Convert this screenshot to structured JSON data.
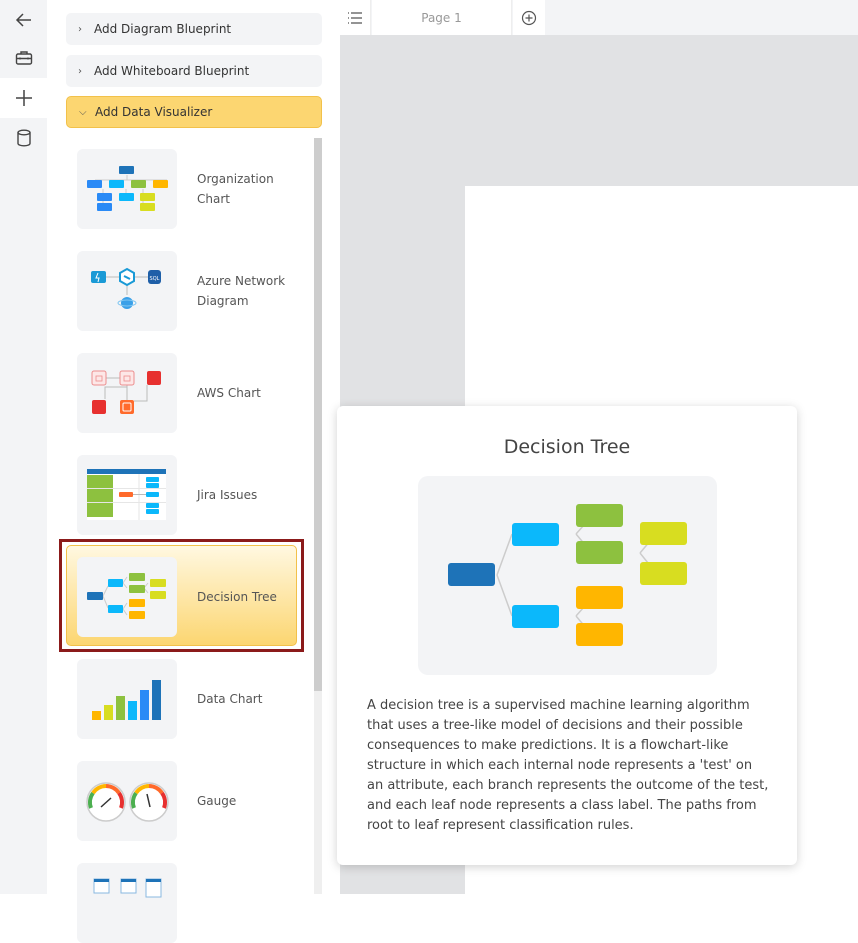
{
  "rail": {
    "items": [
      {
        "name": "back",
        "icon": "arrow-left-icon",
        "active": false
      },
      {
        "name": "toolbox",
        "icon": "briefcase-icon",
        "active": false
      },
      {
        "name": "add",
        "icon": "plus-icon",
        "active": true
      },
      {
        "name": "data",
        "icon": "database-icon",
        "active": false
      }
    ]
  },
  "sidebar": {
    "sections": [
      {
        "label": "Add Diagram Blueprint",
        "expanded": false
      },
      {
        "label": "Add Whiteboard Blueprint",
        "expanded": false
      },
      {
        "label": "Add Data Visualizer",
        "expanded": true
      }
    ],
    "templates": [
      {
        "label": "Organization Chart",
        "selected": false
      },
      {
        "label": "Azure Network Diagram",
        "selected": false
      },
      {
        "label": "AWS Chart",
        "selected": false
      },
      {
        "label": "Jira Issues",
        "selected": false
      },
      {
        "label": "Decision Tree",
        "selected": true
      },
      {
        "label": "Data Chart",
        "selected": false
      },
      {
        "label": "Gauge",
        "selected": false
      },
      {
        "label": "",
        "selected": false
      }
    ]
  },
  "pagebar": {
    "menu_icon": "list-icon",
    "tabs": [
      {
        "label": "Page 1"
      }
    ],
    "add_icon": "plus-circle-icon"
  },
  "preview": {
    "title": "Decision Tree",
    "description": "A decision tree is a supervised machine learning algorithm that uses a tree-like model of decisions and their possible consequences to make predictions. It is a flowchart-like structure in which each internal node represents a 'test' on an attribute, each branch represents the outcome of the test, and each leaf node represents a class label. The paths from root to leaf represent classification rules."
  },
  "colors": {
    "accent": "#fcd671",
    "selection_border": "#8b1a1a",
    "node_root": "#1e73b8",
    "node_cyan": "#0bb8fb",
    "node_green": "#8dc13f",
    "node_lime": "#d8dd20",
    "node_orange": "#ffb600"
  }
}
